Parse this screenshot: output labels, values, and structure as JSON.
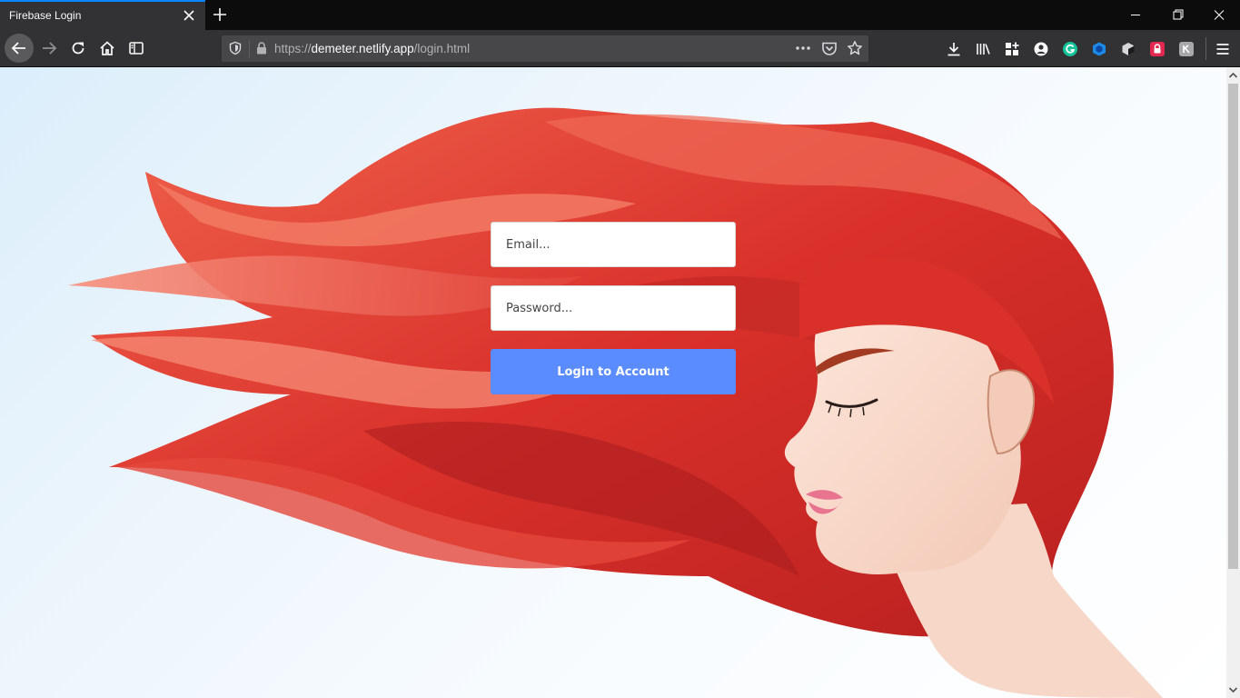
{
  "tab": {
    "title": "Firebase Login"
  },
  "urlbar": {
    "scheme": "https://",
    "host": "demeter.netlify.app",
    "path": "/login.html"
  },
  "login": {
    "email_placeholder": "Email...",
    "password_placeholder": "Password...",
    "submit_label": "Login to Account"
  },
  "colors": {
    "accent": "#5b8cff",
    "tab_highlight": "#0a84ff",
    "hair": "#d9302a"
  },
  "icons": [
    "close-icon",
    "plus-icon",
    "minimize-icon",
    "restore-icon",
    "back-arrow-icon",
    "forward-arrow-icon",
    "reload-icon",
    "home-icon",
    "sidebar-icon",
    "shield-icon",
    "lock-icon",
    "more-icon",
    "pocket-icon",
    "star-icon",
    "download-icon",
    "library-icon",
    "extensions-icon",
    "account-icon",
    "grammarly-icon",
    "cube-icon",
    "dark-cube-icon",
    "red-lock-icon",
    "gray-extension-icon",
    "menu-icon"
  ]
}
